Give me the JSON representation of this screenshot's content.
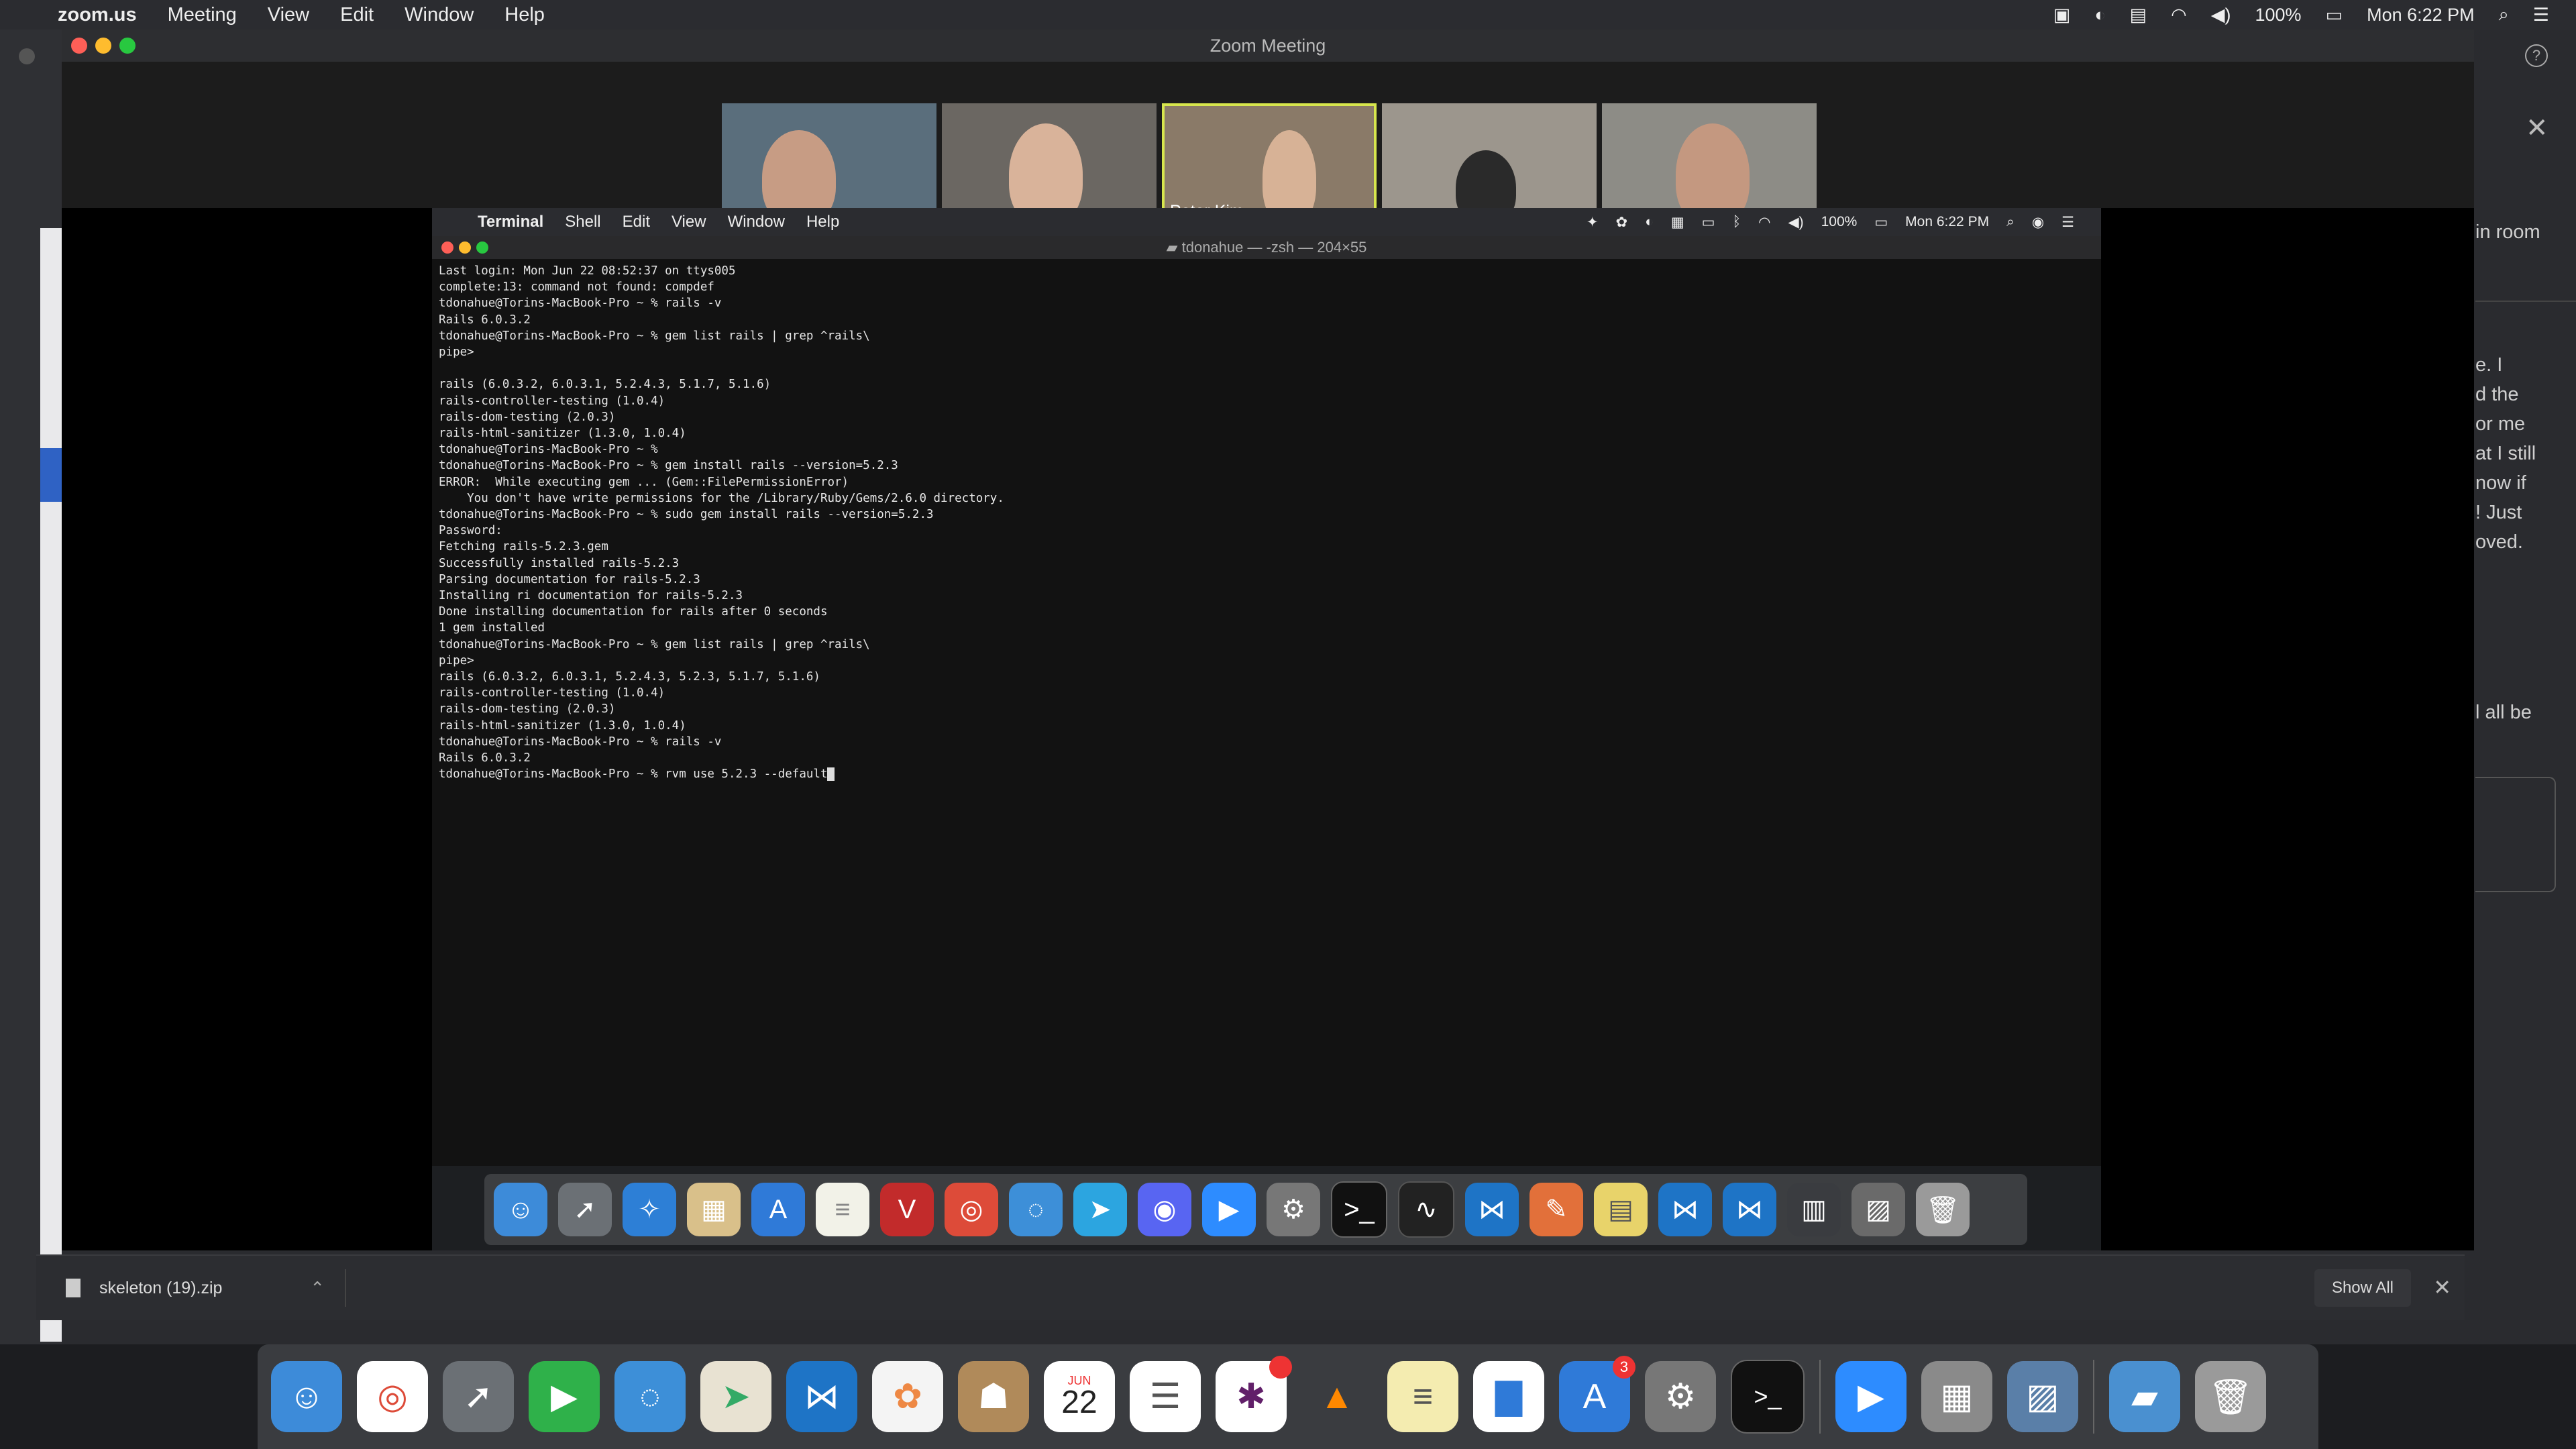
{
  "host_menubar": {
    "app": "zoom.us",
    "items": [
      "Meeting",
      "View",
      "Edit",
      "Window",
      "Help"
    ],
    "battery": "100%",
    "clock": "Mon 6:22 PM"
  },
  "background_app": {
    "sidebar_text": [
      "in room",
      "e. I",
      "d the",
      "or me",
      "at I still",
      "now if",
      "! Just",
      "oved.",
      "l all be"
    ]
  },
  "zoom": {
    "title": "Zoom Meeting",
    "participants": [
      {
        "name": ""
      },
      {
        "name": ""
      },
      {
        "name": "Peter Kim",
        "active": true
      },
      {
        "name": ""
      },
      {
        "name": ""
      }
    ]
  },
  "shared_screen": {
    "menubar": {
      "app": "Terminal",
      "items": [
        "Shell",
        "Edit",
        "View",
        "Window",
        "Help"
      ],
      "battery": "100%",
      "clock": "Mon 6:22 PM"
    },
    "terminal": {
      "title": "tdonahue — -zsh — 204×55",
      "lines": [
        "Last login: Mon Jun 22 08:52:37 on ttys005",
        "complete:13: command not found: compdef",
        "tdonahue@Torins-MacBook-Pro ~ % rails -v",
        "Rails 6.0.3.2",
        "tdonahue@Torins-MacBook-Pro ~ % gem list rails | grep ^rails\\",
        "pipe>",
        "",
        "rails (6.0.3.2, 6.0.3.1, 5.2.4.3, 5.1.7, 5.1.6)",
        "rails-controller-testing (1.0.4)",
        "rails-dom-testing (2.0.3)",
        "rails-html-sanitizer (1.3.0, 1.0.4)",
        "tdonahue@Torins-MacBook-Pro ~ %",
        "tdonahue@Torins-MacBook-Pro ~ % gem install rails --version=5.2.3",
        "ERROR:  While executing gem ... (Gem::FilePermissionError)",
        "    You don't have write permissions for the /Library/Ruby/Gems/2.6.0 directory.",
        "tdonahue@Torins-MacBook-Pro ~ % sudo gem install rails --version=5.2.3",
        "Password:",
        "Fetching rails-5.2.3.gem",
        "Successfully installed rails-5.2.3",
        "Parsing documentation for rails-5.2.3",
        "Installing ri documentation for rails-5.2.3",
        "Done installing documentation for rails after 0 seconds",
        "1 gem installed",
        "tdonahue@Torins-MacBook-Pro ~ % gem list rails | grep ^rails\\",
        "pipe>",
        "rails (6.0.3.2, 6.0.3.1, 5.2.4.3, 5.2.3, 5.1.7, 5.1.6)",
        "rails-controller-testing (1.0.4)",
        "rails-dom-testing (2.0.3)",
        "rails-html-sanitizer (1.3.0, 1.0.4)",
        "tdonahue@Torins-MacBook-Pro ~ % rails -v",
        "Rails 6.0.3.2"
      ],
      "current_input": "tdonahue@Torins-MacBook-Pro ~ % rvm use 5.2.3 --default"
    }
  },
  "download_bar": {
    "file": "skeleton (19).zip",
    "show_all": "Show All"
  },
  "dock": {
    "calendar_month": "JUN",
    "calendar_day": "22",
    "appstore_badge": "3"
  }
}
